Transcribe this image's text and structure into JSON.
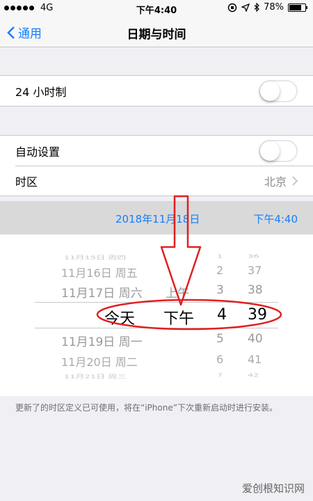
{
  "status": {
    "carrier": "4G",
    "time": "下午4:40",
    "battery": "78%",
    "battery_level": 0.78
  },
  "nav": {
    "back": "通用",
    "title": "日期与时间"
  },
  "rows": {
    "h24": "24 小时制",
    "auto": "自动设置",
    "tz_label": "时区",
    "tz_value": "北京"
  },
  "selected": {
    "date": "2018年11月18日",
    "time": "下午4:40"
  },
  "picker": {
    "dates": [
      "11月15日 周四",
      "11月16日 周五",
      "11月17日 周六",
      "今天",
      "11月19日 周一",
      "11月20日 周二",
      "11月21日 周三"
    ],
    "ampm_prev": "上午",
    "ampm_sel": "下午",
    "hours": [
      "1",
      "2",
      "3",
      "4",
      "5",
      "6",
      "7"
    ],
    "minutes": [
      "36",
      "37",
      "38",
      "39",
      "40",
      "41",
      "42"
    ]
  },
  "note": "更新了的时区定义已可使用，将在“iPhone”下次重新启动时进行安装。",
  "watermark": "爱创根知识网",
  "colors": {
    "accent": "#157efb",
    "annotation_red": "#e02020",
    "separator": "#c8c7cc"
  }
}
